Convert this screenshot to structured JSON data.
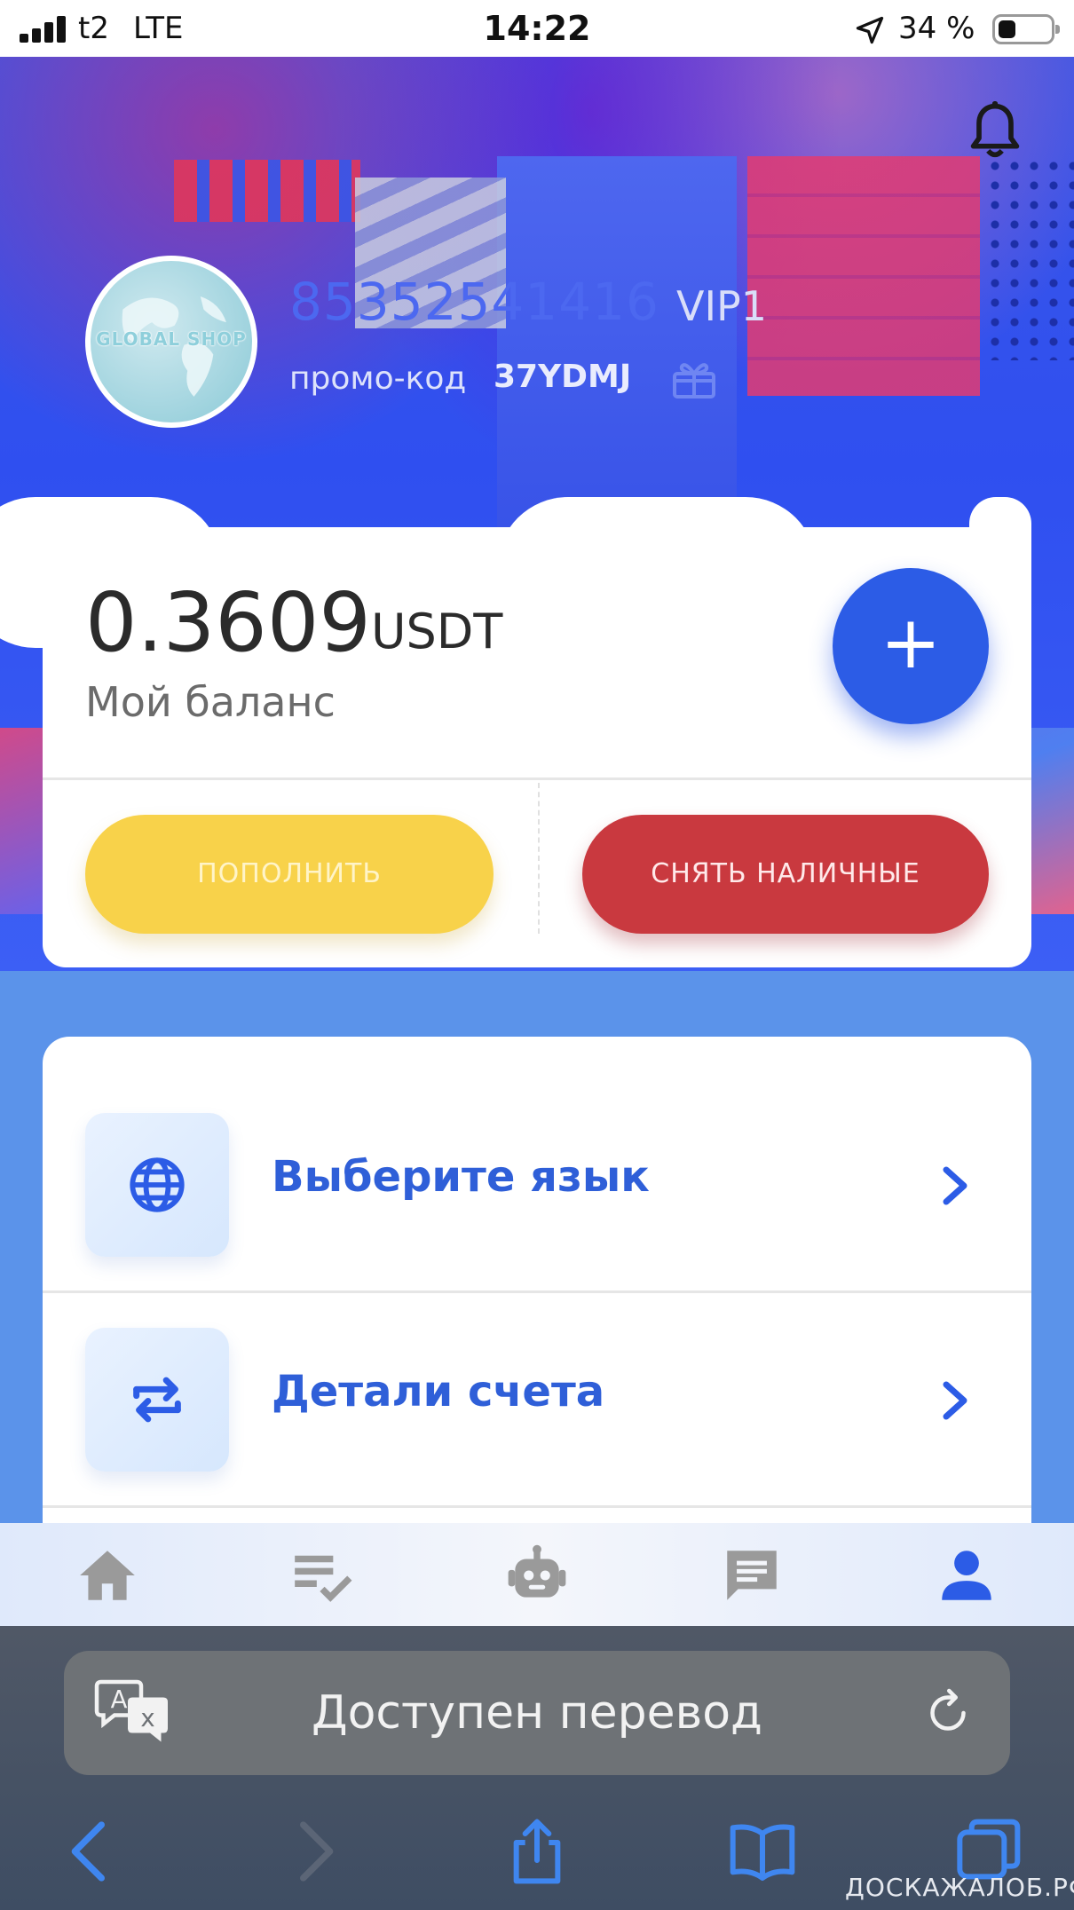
{
  "status_bar": {
    "carrier": "t2",
    "network": "LTE",
    "time": "14:22",
    "battery_text": "34 %",
    "battery_level": 0.34
  },
  "profile": {
    "avatar_text": "GLOBAL SHOP",
    "user_id": "85352541416",
    "vip_level": "VIP1",
    "promo_label": "промо-код",
    "promo_code": "37YDMJ"
  },
  "balance": {
    "value": "0.3609",
    "currency": "USDT",
    "label": "Мой баланс",
    "add_symbol": "+",
    "deposit_label": "ПОПОЛНИТЬ",
    "withdraw_label": "СНЯТЬ НАЛИЧНЫЕ"
  },
  "menu": {
    "items": [
      {
        "label": "Выберите язык",
        "icon": "globe-icon"
      },
      {
        "label": "Детали счета",
        "icon": "swap-arrows-icon"
      }
    ]
  },
  "tabbar": {
    "tabs": [
      {
        "icon": "home-icon",
        "active": false
      },
      {
        "icon": "task-list-icon",
        "active": false
      },
      {
        "icon": "robot-icon",
        "active": false
      },
      {
        "icon": "chat-icon",
        "active": false
      },
      {
        "icon": "person-icon",
        "active": true
      }
    ]
  },
  "browser": {
    "translate_text": "Доступен перевод",
    "watermark": "ДОСКАЖАЛОБ.РФ"
  },
  "colors": {
    "accent_blue": "#2c5ce6",
    "deposit_yellow": "#f8d24a",
    "withdraw_red": "#c9393f",
    "menu_text": "#2f5fd8",
    "tab_active": "#2c5ce6",
    "tab_inactive": "#9a9a9a"
  }
}
